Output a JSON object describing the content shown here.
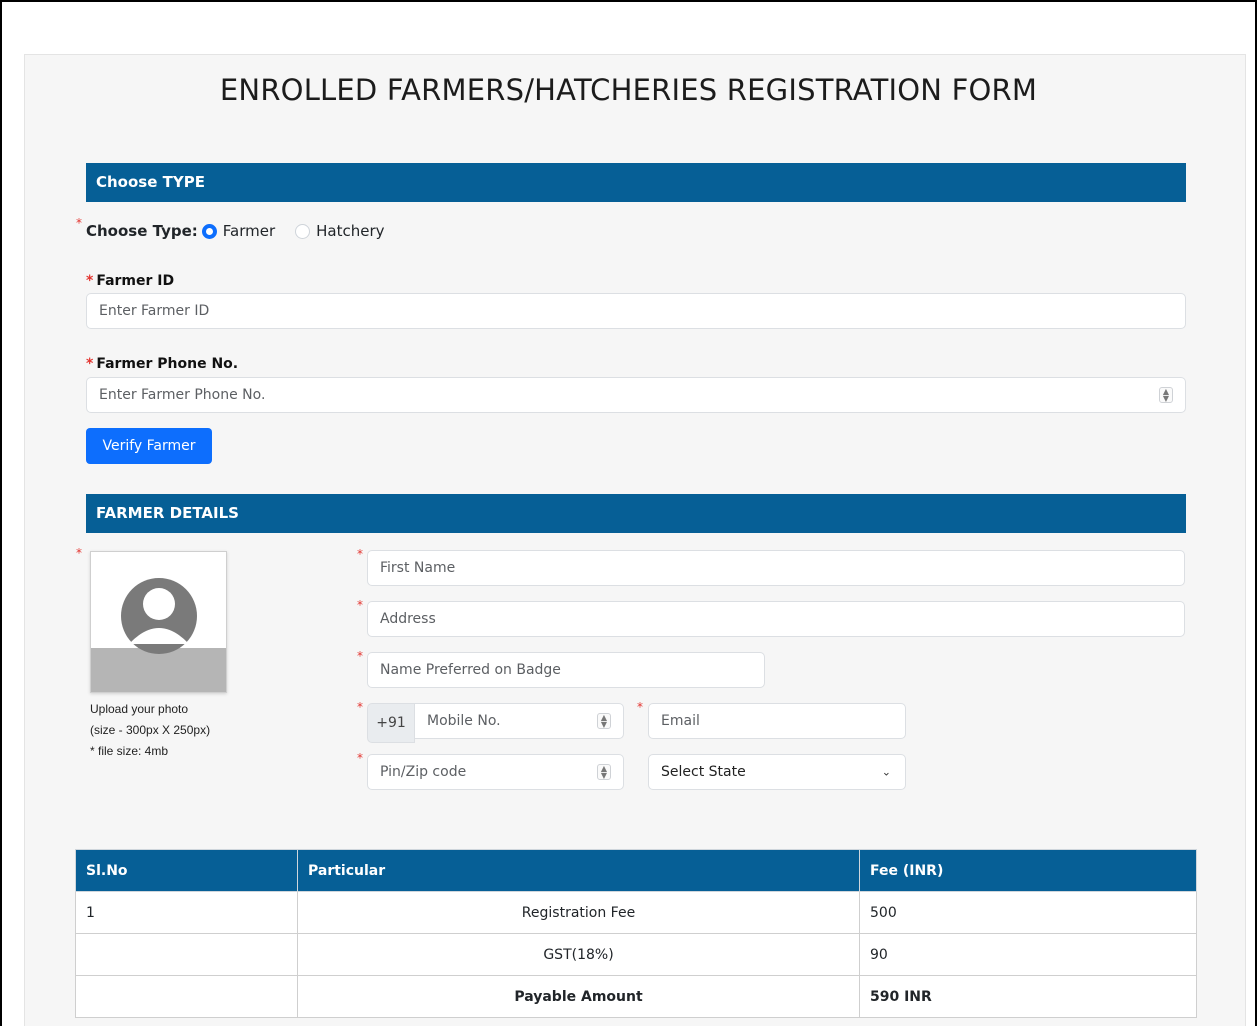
{
  "page": {
    "title": "ENROLLED FARMERS/HATCHERIES REGISTRATION FORM"
  },
  "choose_type": {
    "section_title": "Choose TYPE",
    "label": "Choose Type:",
    "options": [
      {
        "label": "Farmer",
        "checked": true
      },
      {
        "label": "Hatchery",
        "checked": false
      }
    ]
  },
  "verify": {
    "farmer_id_label": "Farmer ID",
    "farmer_id_placeholder": "Enter Farmer ID",
    "phone_label": "Farmer Phone No.",
    "phone_placeholder": "Enter Farmer Phone No.",
    "button_label": "Verify Farmer"
  },
  "details": {
    "section_title": "FARMER DETAILS",
    "photo_hint": [
      "Upload your photo",
      "(size - 300px X 250px)",
      "* file size: 4mb"
    ],
    "first_name_placeholder": "First Name",
    "address_placeholder": "Address",
    "badge_name_placeholder": "Name Preferred on Badge",
    "country_code": "+91",
    "mobile_placeholder": "Mobile No.",
    "email_placeholder": "Email",
    "pin_placeholder": "Pin/Zip code",
    "state_select": "Select State"
  },
  "fees": {
    "headers": [
      "Sl.No",
      "Particular",
      "Fee (INR)"
    ],
    "rows": [
      {
        "sl": "1",
        "particular": "Registration Fee",
        "fee": "500"
      },
      {
        "sl": "",
        "particular": "GST(18%)",
        "fee": "90"
      },
      {
        "sl": "",
        "particular": "Payable Amount",
        "fee": "590 INR"
      }
    ]
  },
  "colors": {
    "section_bar": "#065f96",
    "primary_button": "#0d6efd",
    "required_star": "#e3342f"
  }
}
